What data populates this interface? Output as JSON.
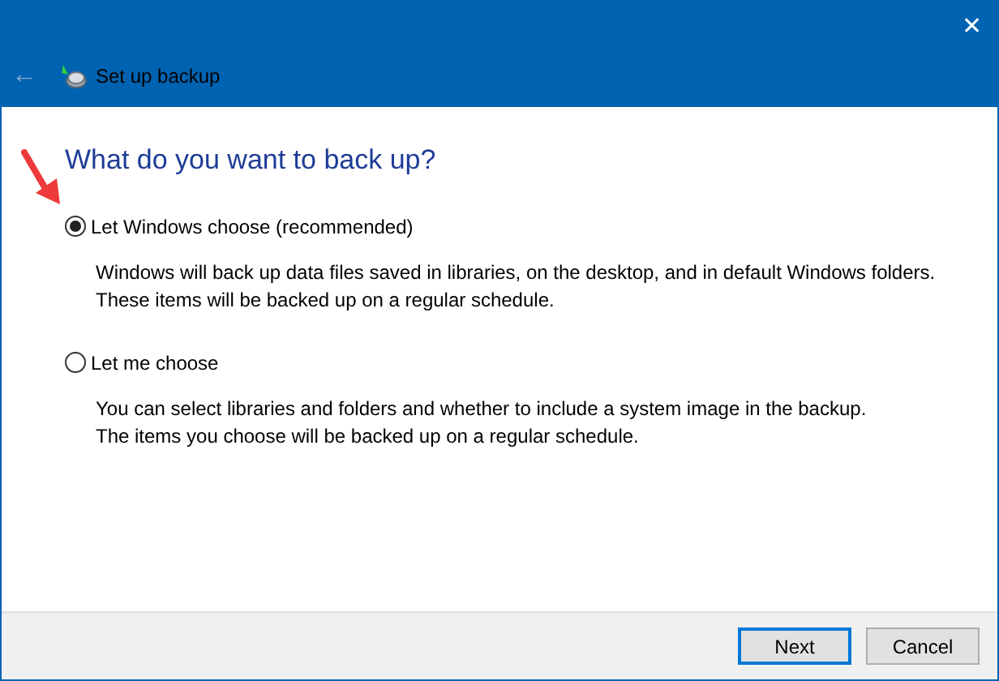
{
  "window": {
    "title": "Set up backup",
    "close": "✕",
    "back": "←"
  },
  "heading": "What do you want to back up?",
  "options": [
    {
      "label": "Let Windows choose (recommended)",
      "selected": true,
      "description": [
        "Windows will back up data files saved in libraries, on the desktop, and in default Windows folders.",
        "These items will be backed up on a regular schedule."
      ]
    },
    {
      "label": "Let me choose",
      "selected": false,
      "description": [
        "You can select libraries and folders and whether to include a system image in the backup.",
        "The items you choose will be backed up on a regular schedule."
      ]
    }
  ],
  "buttons": [
    {
      "label": "Next",
      "default": true
    },
    {
      "label": "Cancel",
      "default": false
    }
  ]
}
